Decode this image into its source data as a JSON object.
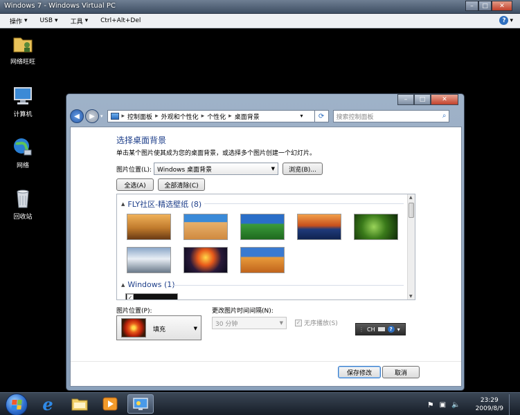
{
  "vpc": {
    "title": "Windows 7 - Windows Virtual PC",
    "menu": [
      "操作",
      "USB",
      "工具",
      "Ctrl+Alt+Del"
    ]
  },
  "desktop": {
    "icons": [
      "网络旺旺",
      "计算机",
      "网络",
      "回收站"
    ]
  },
  "explorer": {
    "breadcrumb": [
      "控制面板",
      "外观和个性化",
      "个性化",
      "桌面背景"
    ],
    "search_placeholder": "搜索控制面板"
  },
  "page": {
    "heading": "选择桌面背景",
    "subtitle": "单击某个图片使其成为您的桌面背景，或选择多个图片创建一个幻灯片。",
    "location_label": "图片位置(L):",
    "location_value": "Windows 桌面背景",
    "browse_label": "浏览(B)...",
    "select_all_label": "全选(A)",
    "clear_all_label": "全部清除(C)",
    "groups": [
      {
        "name": "FLY社区-精选壁纸 (8)"
      },
      {
        "name": "Windows (1)"
      }
    ],
    "position_label": "图片位置(P):",
    "position_value": "填充",
    "interval_label": "更改图片时间间隔(N):",
    "interval_value": "30 分钟",
    "shuffle_label": "无序播放(S)",
    "save_label": "保存修改",
    "cancel_label": "取消"
  },
  "langbar": {
    "text": "CH"
  },
  "taskbar": {
    "time": "23:29",
    "date": "2009/8/9"
  }
}
